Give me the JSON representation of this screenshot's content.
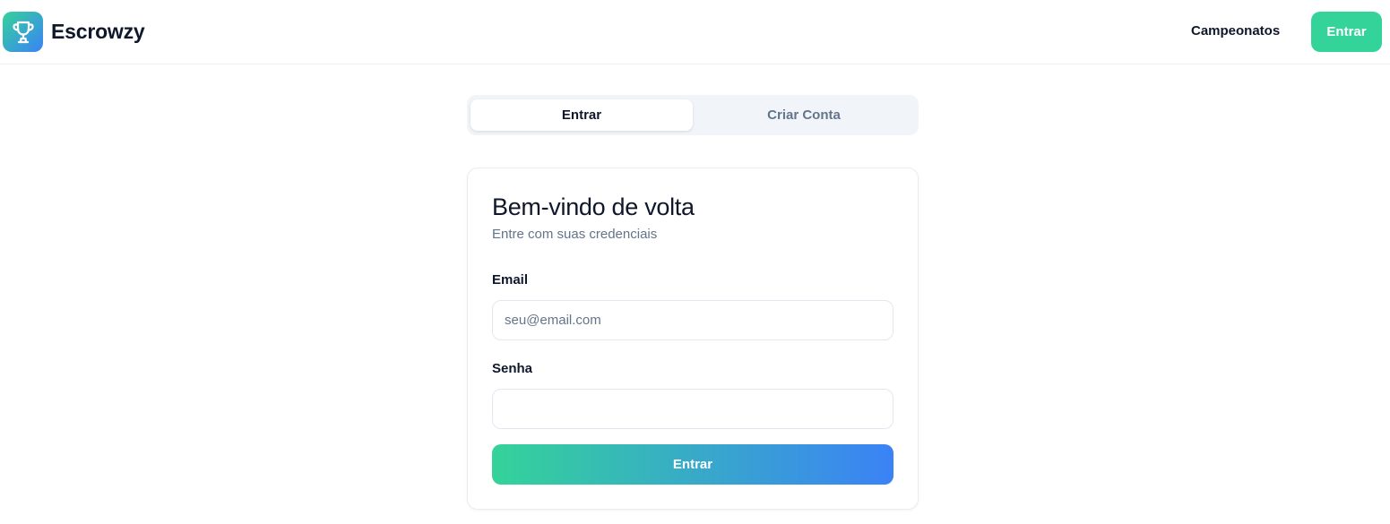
{
  "header": {
    "brand": "Escrowzy",
    "logo_icon": "trophy-icon",
    "nav_link": "Campeonatos",
    "login_button": "Entrar"
  },
  "tabs": [
    {
      "label": "Entrar",
      "active": true
    },
    {
      "label": "Criar Conta",
      "active": false
    }
  ],
  "card": {
    "title": "Bem-vindo de volta",
    "subtitle": "Entre com suas credenciais",
    "email_label": "Email",
    "email_placeholder": "seu@email.com",
    "email_value": "",
    "password_label": "Senha",
    "password_value": "",
    "submit_label": "Entrar"
  },
  "colors": {
    "accent": "#34d399",
    "gradient_end": "#3b82f6",
    "text": "#0f172a",
    "muted": "#64748b"
  }
}
